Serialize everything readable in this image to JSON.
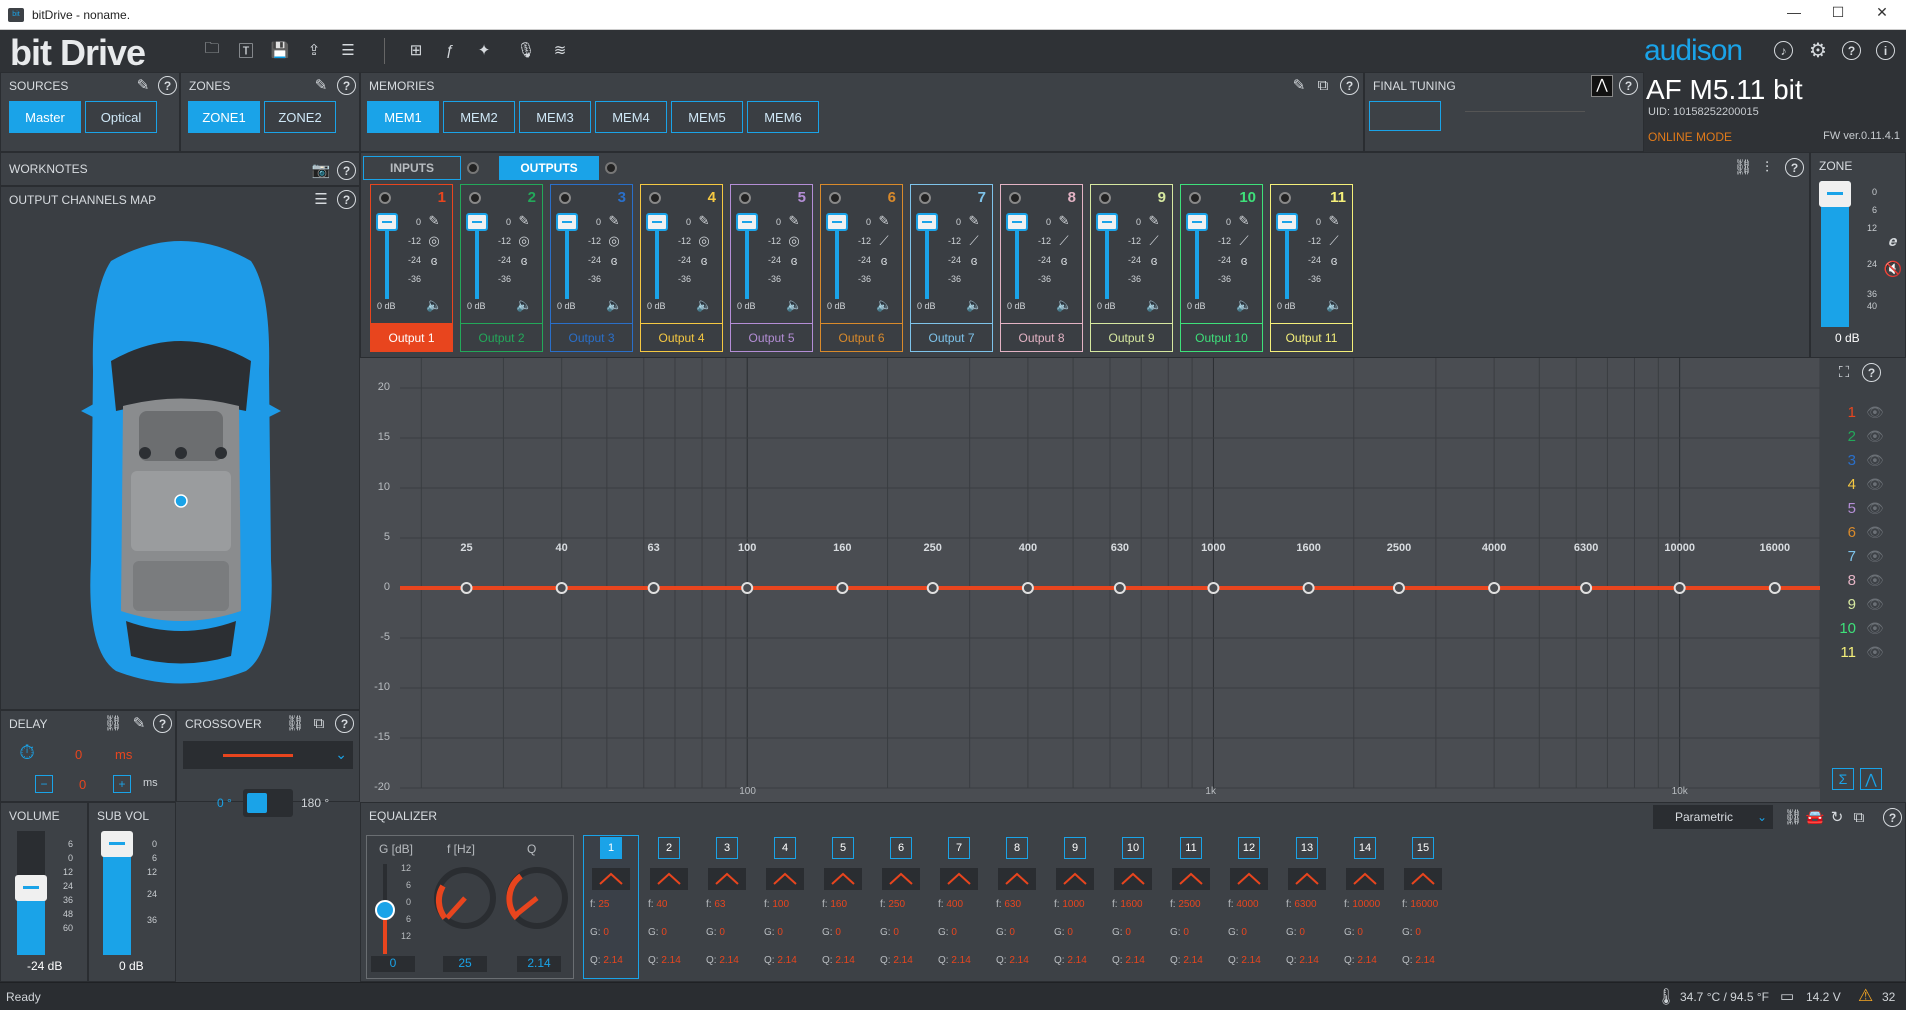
{
  "window": {
    "title": "bitDrive - noname.",
    "controls": [
      "—",
      "☐",
      "✕"
    ]
  },
  "app": {
    "logo": "bit Drive",
    "brand": "audison"
  },
  "device": {
    "name": "AF M5.11 bit",
    "uid": "UID: 10158252200015",
    "mode": "ONLINE MODE",
    "fw": "FW ver.0.11.4.1"
  },
  "sources": {
    "title": "SOURCES",
    "items": [
      "Master",
      "Optical"
    ],
    "active": 0
  },
  "zones": {
    "title": "ZONES",
    "items": [
      "ZONE1",
      "ZONE2"
    ],
    "active": 0
  },
  "memories": {
    "title": "MEMORIES",
    "items": [
      "MEM1",
      "MEM2",
      "MEM3",
      "MEM4",
      "MEM5",
      "MEM6"
    ],
    "active": 0
  },
  "final_tuning": {
    "title": "FINAL TUNING"
  },
  "worknotes": {
    "title": "WORKNOTES"
  },
  "channels_map": {
    "title": "OUTPUT CHANNELS MAP"
  },
  "io_tabs": {
    "inputs": "INPUTS",
    "outputs": "OUTPUTS"
  },
  "outputs": [
    {
      "num": "1",
      "label": "Output 1",
      "color": "#e8451e",
      "scale": [
        "0",
        "-12",
        "-24",
        "-36"
      ],
      "db": "0 dB"
    },
    {
      "num": "2",
      "label": "Output 2",
      "color": "#23a85a",
      "scale": [
        "0",
        "-12",
        "-24",
        "-36"
      ],
      "db": "0 dB"
    },
    {
      "num": "3",
      "label": "Output 3",
      "color": "#2a6fc9",
      "scale": [
        "0",
        "-12",
        "-24",
        "-36"
      ],
      "db": "0 dB"
    },
    {
      "num": "4",
      "label": "Output 4",
      "color": "#f5c842",
      "scale": [
        "0",
        "-12",
        "-24",
        "-36"
      ],
      "db": "0 dB"
    },
    {
      "num": "5",
      "label": "Output 5",
      "color": "#b48ed6",
      "scale": [
        "0",
        "-12",
        "-24",
        "-36"
      ],
      "db": "0 dB"
    },
    {
      "num": "6",
      "label": "Output 6",
      "color": "#d98a2b",
      "scale": [
        "0",
        "-12",
        "-24",
        "-36"
      ],
      "db": "0 dB"
    },
    {
      "num": "7",
      "label": "Output 7",
      "color": "#7ec3ea",
      "scale": [
        "0",
        "-12",
        "-24",
        "-36"
      ],
      "db": "0 dB"
    },
    {
      "num": "8",
      "label": "Output 8",
      "color": "#e3b3c4",
      "scale": [
        "0",
        "-12",
        "-24",
        "-36"
      ],
      "db": "0 dB"
    },
    {
      "num": "9",
      "label": "Output 9",
      "color": "#d6e8a0",
      "scale": [
        "0",
        "-12",
        "-24",
        "-36"
      ],
      "db": "0 dB"
    },
    {
      "num": "10",
      "label": "Output 10",
      "color": "#3ee07a",
      "scale": [
        "0",
        "-12",
        "-24",
        "-36"
      ],
      "db": "0 dB"
    },
    {
      "num": "11",
      "label": "Output 11",
      "color": "#f5f07a",
      "scale": [
        "0",
        "-12",
        "-24",
        "-36"
      ],
      "db": "0 dB"
    }
  ],
  "zone_fader": {
    "title": "ZONE",
    "scale": [
      "0",
      "6",
      "12",
      "24",
      "36",
      "40"
    ],
    "value": "0 dB"
  },
  "graph": {
    "y_ticks": [
      "20",
      "15",
      "10",
      "5",
      "0",
      "-5",
      "-10",
      "-15",
      "-20"
    ],
    "x_ticks": [
      "100",
      "1k",
      "10k"
    ],
    "band_freqs": [
      "25",
      "40",
      "63",
      "100",
      "160",
      "250",
      "400",
      "630",
      "1000",
      "1600",
      "2500",
      "4000",
      "6300",
      "10000",
      "16000"
    ],
    "legend": [
      "1",
      "2",
      "3",
      "4",
      "5",
      "6",
      "7",
      "8",
      "9",
      "10",
      "11"
    ]
  },
  "delay": {
    "title": "DELAY",
    "value1": "0",
    "unit1": "ms",
    "value2": "0",
    "unit2": "ms"
  },
  "crossover": {
    "title": "CROSSOVER",
    "phase0": "0 °",
    "phase180": "180 °"
  },
  "volume": {
    "title": "VOLUME",
    "scale": [
      "6",
      "0",
      "12",
      "24",
      "36",
      "48",
      "60"
    ],
    "value": "-24 dB"
  },
  "subvol": {
    "title": "SUB VOL",
    "scale": [
      "0",
      "6",
      "12",
      "24",
      "36"
    ],
    "value": "0 dB"
  },
  "equalizer": {
    "title": "EQUALIZER",
    "mode": "Parametric",
    "headers": {
      "g": "G [dB]",
      "f": "f [Hz]",
      "q": "Q"
    },
    "g_scale": [
      "12",
      "6",
      "0",
      "6",
      "12"
    ],
    "g_value": "0",
    "f_value": "25",
    "q_value": "2.14",
    "band_prefix": {
      "f": "f:",
      "g": "G:",
      "q": "Q:"
    },
    "bands": [
      {
        "n": "1",
        "f": "25",
        "g": "0",
        "q": "2.14"
      },
      {
        "n": "2",
        "f": "40",
        "g": "0",
        "q": "2.14"
      },
      {
        "n": "3",
        "f": "63",
        "g": "0",
        "q": "2.14"
      },
      {
        "n": "4",
        "f": "100",
        "g": "0",
        "q": "2.14"
      },
      {
        "n": "5",
        "f": "160",
        "g": "0",
        "q": "2.14"
      },
      {
        "n": "6",
        "f": "250",
        "g": "0",
        "q": "2.14"
      },
      {
        "n": "7",
        "f": "400",
        "g": "0",
        "q": "2.14"
      },
      {
        "n": "8",
        "f": "630",
        "g": "0",
        "q": "2.14"
      },
      {
        "n": "9",
        "f": "1000",
        "g": "0",
        "q": "2.14"
      },
      {
        "n": "10",
        "f": "1600",
        "g": "0",
        "q": "2.14"
      },
      {
        "n": "11",
        "f": "2500",
        "g": "0",
        "q": "2.14"
      },
      {
        "n": "12",
        "f": "4000",
        "g": "0",
        "q": "2.14"
      },
      {
        "n": "13",
        "f": "6300",
        "g": "0",
        "q": "2.14"
      },
      {
        "n": "14",
        "f": "10000",
        "g": "0",
        "q": "2.14"
      },
      {
        "n": "15",
        "f": "16000",
        "g": "0",
        "q": "2.14"
      }
    ]
  },
  "status": {
    "text": "Ready",
    "temp": "34.7 °C / 94.5 °F",
    "voltage": "14.2 V",
    "warnings": "32"
  },
  "colors": {
    "accent": "#1aa3e8",
    "curve": "#e8451e",
    "bg": "#3b3f44",
    "graph_bg": "#4a4d52"
  }
}
